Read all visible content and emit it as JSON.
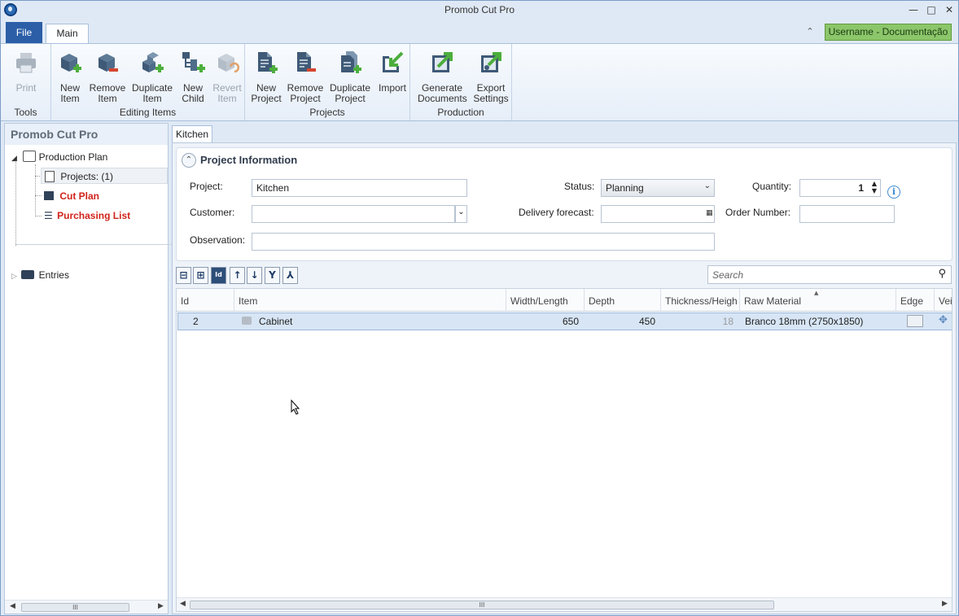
{
  "window": {
    "title": "Promob Cut Pro"
  },
  "ribbon_tabs": {
    "file": "File",
    "main": "Main"
  },
  "user_badge": "Username - Documentação",
  "ribbon": {
    "tools": {
      "label": "Tools",
      "print": "Print"
    },
    "editing": {
      "label": "Editing Items",
      "new_item": "New\nItem",
      "remove_item": "Remove\nItem",
      "duplicate_item": "Duplicate\nItem",
      "new_child": "New\nChild",
      "revert_item": "Revert\nItem"
    },
    "projects": {
      "label": "Projects",
      "new_project": "New\nProject",
      "remove_project": "Remove\nProject",
      "duplicate_project": "Duplicate\nProject",
      "import": "Import"
    },
    "production": {
      "label": "Production",
      "generate_documents": "Generate\nDocuments",
      "export_settings": "Export\nSettings"
    }
  },
  "left_pane": {
    "title": "Promob Cut Pro",
    "tree": {
      "production_plan": "Production Plan",
      "projects": "Projects: (1)",
      "cut_plan": "Cut Plan",
      "purchasing_list": "Purchasing List",
      "entries": "Entries"
    }
  },
  "doc_tab": "Kitchen",
  "project_info": {
    "title": "Project Information",
    "project_label": "Project:",
    "project_value": "Kitchen",
    "customer_label": "Customer:",
    "customer_value": "",
    "observation_label": "Observation:",
    "observation_value": "",
    "status_label": "Status:",
    "status_value": "Planning",
    "delivery_label": "Delivery forecast:",
    "delivery_value": "",
    "quantity_label": "Quantity:",
    "quantity_value": "1",
    "order_label": "Order Number:",
    "order_value": ""
  },
  "search": {
    "placeholder": "Search"
  },
  "grid": {
    "columns": [
      "Id",
      "Item",
      "Width/Length",
      "Depth",
      "Thickness/Heigh",
      "Raw Material",
      "Edge",
      "Vei"
    ],
    "rows": [
      {
        "id": "2",
        "item": "Cabinet",
        "width": "650",
        "depth": "450",
        "thickness": "18",
        "material": "Branco 18mm (2750x1850)"
      }
    ]
  },
  "colors": {
    "accent": "#2b5ea7",
    "user_badge": "#8cc66a",
    "tree_highlight": "#d0231c",
    "selected_row": "#d7e5f5"
  }
}
